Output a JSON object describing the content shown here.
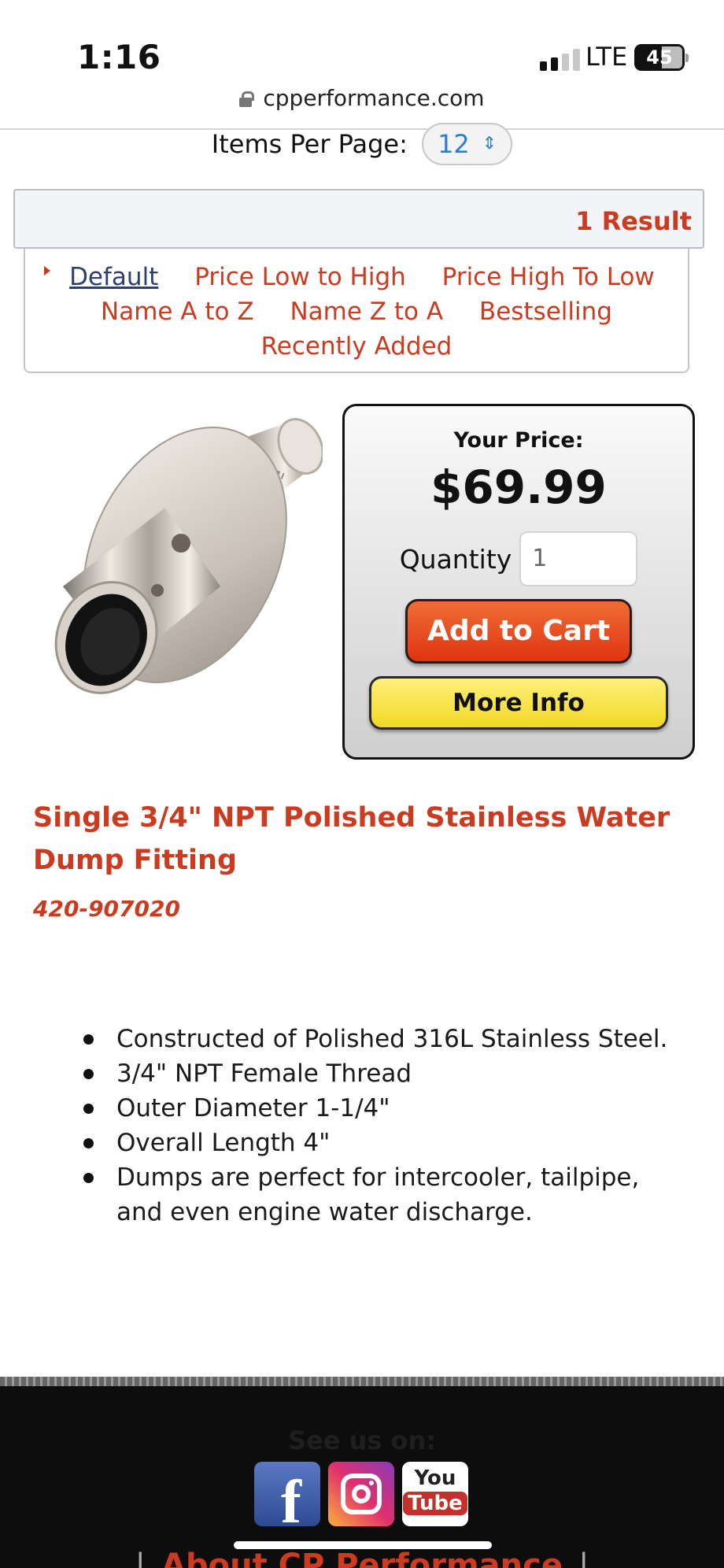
{
  "status_bar": {
    "time": "1:16",
    "network": "LTE",
    "battery": "45"
  },
  "browser": {
    "url": "cpperformance.com"
  },
  "listing": {
    "items_per_page_label": "Items Per Page:",
    "items_per_page_value": "12",
    "result_count": "1 Result",
    "sort_options": [
      "Default",
      "Price Low to High",
      "Price High To Low",
      "Name A to Z",
      "Name Z to A",
      "Bestselling",
      "Recently Added"
    ],
    "active_sort": "Default"
  },
  "product": {
    "price_label": "Your Price:",
    "price": "$69.99",
    "quantity_label": "Quantity",
    "quantity_value": "1",
    "add_to_cart": "Add to Cart",
    "more_info": "More Info",
    "title": "Single 3/4\" NPT Polished Stainless Water Dump Fitting",
    "sku": "420-907020",
    "features": [
      "Constructed of Polished 316L Stainless Steel.",
      "3/4\" NPT Female Thread",
      "Outer Diameter 1-1/4\"",
      "Overall Length 4\"",
      "Dumps are perfect for intercooler, tailpipe, and even engine water discharge."
    ]
  },
  "footer": {
    "see_us_on": "See us on:",
    "social": [
      "facebook-icon",
      "instagram-icon",
      "youtube-icon"
    ],
    "youtube_logo": {
      "top": "You",
      "bottom": "Tube"
    },
    "about_link": "About CP Performance"
  },
  "colors": {
    "accent": "#cc3a1f",
    "cart_button": "#e8471c",
    "info_button": "#f5e03a",
    "link_active": "#2f3f6b"
  }
}
